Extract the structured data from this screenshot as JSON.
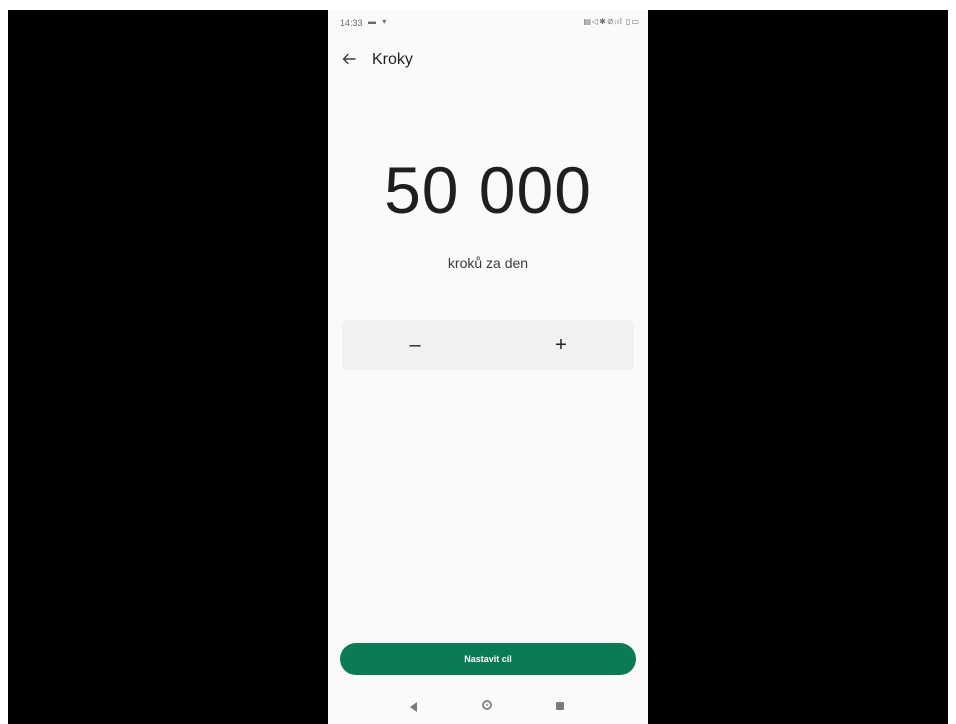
{
  "status_bar": {
    "time": "14:33",
    "left_icons": "▬ ▾",
    "right_icons": "▤◁✱⊘ᵢıl ▯▭"
  },
  "app_bar": {
    "title": "Kroky"
  },
  "goal": {
    "value": "50 000",
    "unit": "kroků za den"
  },
  "stepper": {
    "minus_label": "–",
    "plus_label": "+"
  },
  "action": {
    "set_goal_label": "Nastavit cíl"
  },
  "colors": {
    "accent": "#0b7a57",
    "background": "#fafafa",
    "letterbox": "#000000"
  }
}
